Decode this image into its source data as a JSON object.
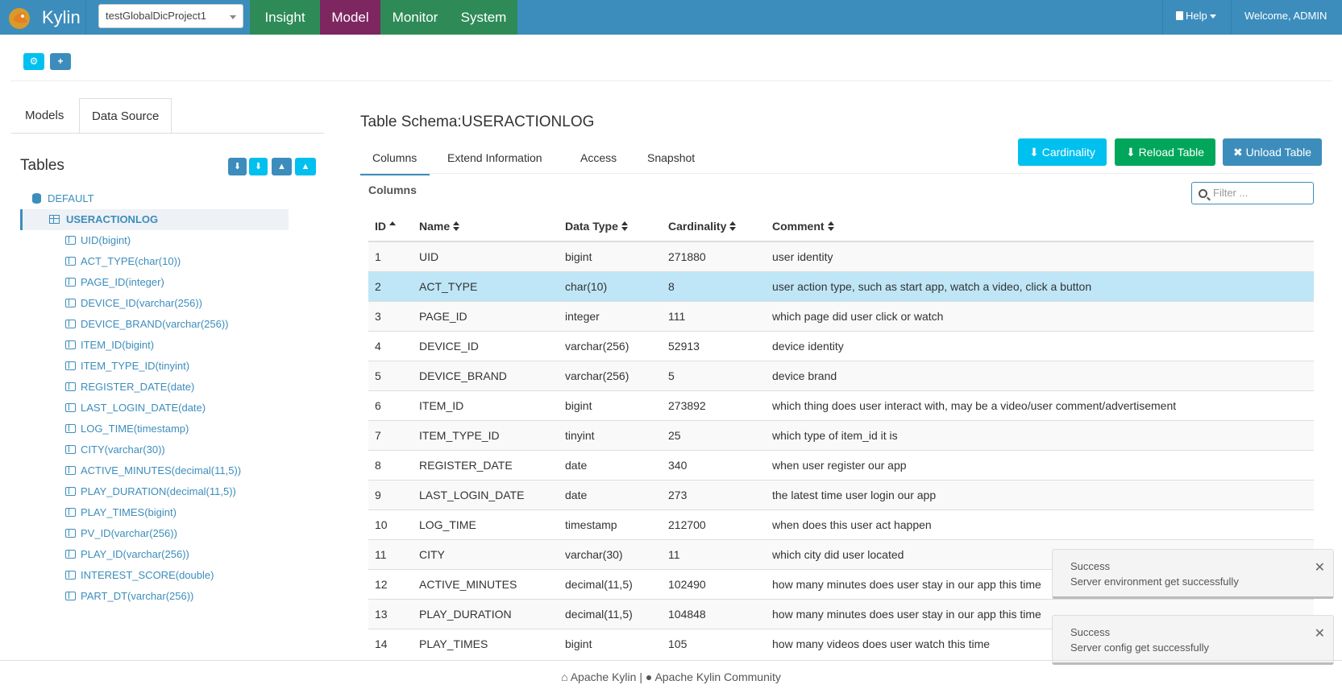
{
  "navbar": {
    "brand": "Kylin",
    "project": "testGlobalDicProject1",
    "items": [
      "Insight",
      "Model",
      "Monitor",
      "System"
    ],
    "help": "Help",
    "welcome": "Welcome, ADMIN"
  },
  "left": {
    "tabs": [
      "Models",
      "Data Source"
    ],
    "tables_title": "Tables",
    "database": "DEFAULT",
    "table": "USERACTIONLOG",
    "columns": [
      "UID(bigint)",
      "ACT_TYPE(char(10))",
      "PAGE_ID(integer)",
      "DEVICE_ID(varchar(256))",
      "DEVICE_BRAND(varchar(256))",
      "ITEM_ID(bigint)",
      "ITEM_TYPE_ID(tinyint)",
      "REGISTER_DATE(date)",
      "LAST_LOGIN_DATE(date)",
      "LOG_TIME(timestamp)",
      "CITY(varchar(30))",
      "ACTIVE_MINUTES(decimal(11,5))",
      "PLAY_DURATION(decimal(11,5))",
      "PLAY_TIMES(bigint)",
      "PV_ID(varchar(256))",
      "PLAY_ID(varchar(256))",
      "INTEREST_SCORE(double)",
      "PART_DT(varchar(256))"
    ]
  },
  "main": {
    "title": "Table Schema:USERACTIONLOG",
    "tabs": [
      "Columns",
      "Extend Information",
      "Access",
      "Snapshot"
    ],
    "buttons": {
      "cardinality": "Cardinality",
      "reload": "Reload Table",
      "unload": "Unload Table"
    },
    "columns_label": "Columns",
    "filter_placeholder": "Filter ...",
    "headers": [
      "ID",
      "Name",
      "Data Type",
      "Cardinality",
      "Comment"
    ],
    "rows": [
      [
        "1",
        "UID",
        "bigint",
        "271880",
        "user identity"
      ],
      [
        "2",
        "ACT_TYPE",
        "char(10)",
        "8",
        "user action type, such as start app, watch a video, click a button"
      ],
      [
        "3",
        "PAGE_ID",
        "integer",
        "111",
        "which page did user click or watch"
      ],
      [
        "4",
        "DEVICE_ID",
        "varchar(256)",
        "52913",
        "device identity"
      ],
      [
        "5",
        "DEVICE_BRAND",
        "varchar(256)",
        "5",
        "device brand"
      ],
      [
        "6",
        "ITEM_ID",
        "bigint",
        "273892",
        "which thing does user interact with, may be a video/user comment/advertisement"
      ],
      [
        "7",
        "ITEM_TYPE_ID",
        "tinyint",
        "25",
        "which type of item_id it is"
      ],
      [
        "8",
        "REGISTER_DATE",
        "date",
        "340",
        "when user register our app"
      ],
      [
        "9",
        "LAST_LOGIN_DATE",
        "date",
        "273",
        "the latest time user login our app"
      ],
      [
        "10",
        "LOG_TIME",
        "timestamp",
        "212700",
        "when does this user act happen"
      ],
      [
        "11",
        "CITY",
        "varchar(30)",
        "11",
        "which city did user located"
      ],
      [
        "12",
        "ACTIVE_MINUTES",
        "decimal(11,5)",
        "102490",
        "how many minutes does user stay in our app this time"
      ],
      [
        "13",
        "PLAY_DURATION",
        "decimal(11,5)",
        "104848",
        "how many minutes does user stay in our app this time"
      ],
      [
        "14",
        "PLAY_TIMES",
        "bigint",
        "105",
        "how many videos does user watch this time"
      ]
    ]
  },
  "toasts": [
    {
      "title": "Success",
      "message": "Server environment get successfully"
    },
    {
      "title": "Success",
      "message": "Server config get successfully"
    }
  ],
  "footer": {
    "left": "Apache Kylin",
    "sep": "|",
    "right": "Apache Kylin Community"
  },
  "colors": {
    "navbar": "#3c8dbc",
    "nav_green": "#2e8b57",
    "nav_active": "#7d2660",
    "selected_row": "#bee6f7",
    "info_button": "#00c0ef",
    "success_button": "#00a65a"
  }
}
